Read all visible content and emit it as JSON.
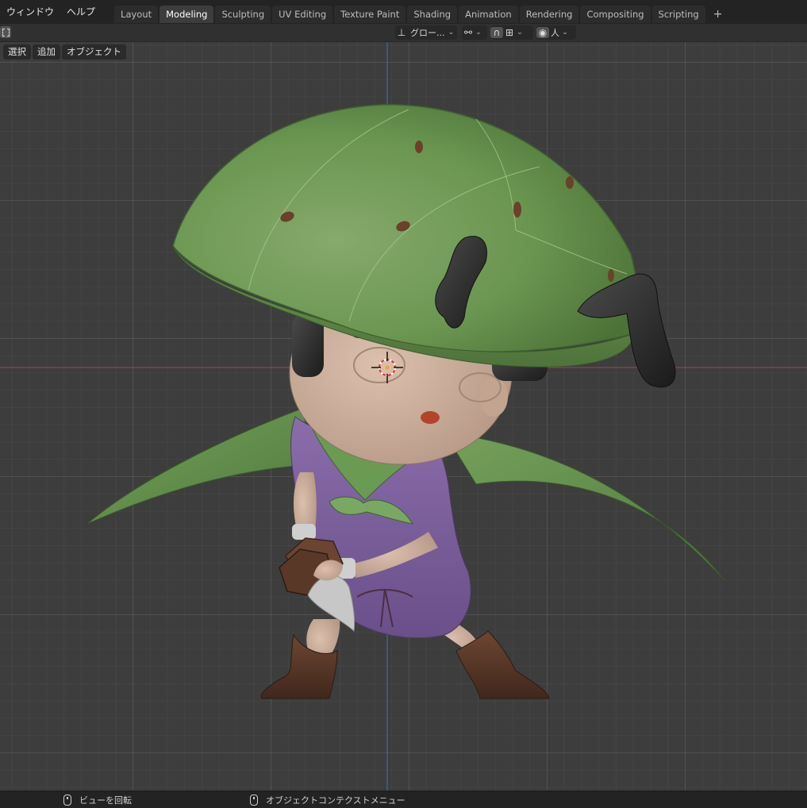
{
  "menu": {
    "window": "ウィンドウ",
    "help": "ヘルプ"
  },
  "workspaces": [
    {
      "label": "Layout",
      "active": false
    },
    {
      "label": "Modeling",
      "active": true
    },
    {
      "label": "Sculpting",
      "active": false
    },
    {
      "label": "UV Editing",
      "active": false
    },
    {
      "label": "Texture Paint",
      "active": false
    },
    {
      "label": "Shading",
      "active": false
    },
    {
      "label": "Animation",
      "active": false
    },
    {
      "label": "Rendering",
      "active": false
    },
    {
      "label": "Compositing",
      "active": false
    },
    {
      "label": "Scripting",
      "active": false
    }
  ],
  "workspace_add": "+",
  "header": {
    "orientation_label": "グロー...",
    "orientation_icon": "transform-orientation-icon",
    "pivot_icon": "pivot-point-icon",
    "snap_icon": "snap-magnet-icon",
    "snap_target_icon": "snap-increment-icon",
    "proportional_icon": "proportional-edit-icon",
    "falloff_label": "人",
    "mode_icon": "object-mode-icon"
  },
  "viewport_menu": {
    "select": "選択",
    "add": "追加",
    "object": "オブジェクト"
  },
  "status": {
    "left_action": "ビューを回転",
    "middle_action": "オブジェクトコンテクストメニュー"
  },
  "colors": {
    "ui_dark": "#232323",
    "viewport_bg": "#3d3d3d",
    "active_tab": "#3d3d3d",
    "x_axis": "#b3454c",
    "y_axis": "#3f78b8",
    "hat_green": "#6a9550",
    "tunic_purple": "#7b5e9c",
    "skin": "#ccab98",
    "boot_brown": "#553527"
  }
}
